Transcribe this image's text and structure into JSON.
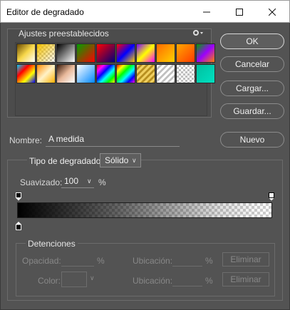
{
  "window": {
    "title": "Editor de degradado"
  },
  "presets": {
    "label": "Ajustes preestablecidos",
    "swatches": [
      "linear-gradient(135deg,#6b4a00,#f7d74a,#ffffff)",
      "linear-gradient(135deg,#f3c000,rgba(255,200,0,0)) , repeating-conic-gradient(#bfbfbf 0% 25%, #fff 0% 50%) 0 0/6px 6px",
      "linear-gradient(135deg,#000,#fff)",
      "linear-gradient(135deg,#00a000,#ff0000)",
      "linear-gradient(135deg,#ff0000,#00007a)",
      "linear-gradient(135deg,#ff0000,#0000ff,#ffcc00)",
      "linear-gradient(135deg,#7a00ff,#ffff00,#ff00ff)",
      "linear-gradient(135deg,#ff6a00,#ffd200)",
      "linear-gradient(135deg,#ffa800,#ff3c00)",
      "linear-gradient(135deg,#00a000,#9b00ff,#ff8000)",
      "linear-gradient(135deg,#00d0ff,#ff0000,#ffff00,#0000ff)",
      "linear-gradient(135deg,#ff8c00,#fff2c8,#ffb000)",
      "linear-gradient(135deg,#3a1a0a,#e8b89a,#ffffff)",
      "linear-gradient(135deg,#ffffff,#0088ff)",
      "linear-gradient(135deg,#ff0000,#ff00ff,#0000ff,#00ffff,#00ff00,#ffff00)",
      "linear-gradient(135deg,#ff0000,#ffff00,#00ff00,#00ffff,#0000ff,#ff00ff)",
      "repeating-linear-gradient(135deg,#f0d060 0 3px,#b89020 3px 6px)",
      "repeating-linear-gradient(135deg,#ffffff 0 3px,#c0c0c0 3px 6px)",
      "repeating-conic-gradient(#bfbfbf 0% 25%, #fff 0% 50%) 0 0/6px 6px",
      "linear-gradient(135deg,#00c0a0,#00e0c0)"
    ]
  },
  "buttons": {
    "ok": "OK",
    "cancel": "Cancelar",
    "load": "Cargar...",
    "save": "Guardar...",
    "new": "Nuevo"
  },
  "name": {
    "label": "Nombre:",
    "value": "A medida"
  },
  "gradient": {
    "type_label": "Tipo de degradado:",
    "type_value": "Sólido",
    "smooth_label": "Suavizado:",
    "smooth_value": "100",
    "smooth_unit": "%"
  },
  "stops": {
    "label": "Detenciones",
    "opacity_label": "Opacidad:",
    "opacity_unit": "%",
    "location_label": "Ubicación:",
    "location_unit": "%",
    "delete_label": "Eliminar",
    "color_label": "Color:"
  }
}
